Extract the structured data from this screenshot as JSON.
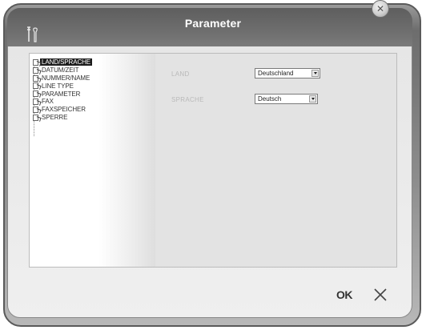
{
  "window": {
    "title": "Parameter",
    "close_icon": "close-icon",
    "app_icon": "tools-icon"
  },
  "tree": {
    "items": [
      {
        "label": "LAND/SPRACHE",
        "selected": true
      },
      {
        "label": "DATUM/ZEIT",
        "selected": false
      },
      {
        "label": "NUMMER/NAME",
        "selected": false
      },
      {
        "label": "LINE TYPE",
        "selected": false
      },
      {
        "label": "PARAMETER",
        "selected": false
      },
      {
        "label": "FAX",
        "selected": false
      },
      {
        "label": "FAXSPEICHER",
        "selected": false
      },
      {
        "label": "SPERRE",
        "selected": false
      }
    ]
  },
  "form": {
    "land_label": "LAND",
    "land_value": "Deutschland",
    "sprache_label": "SPRACHE",
    "sprache_value": "Deutsch"
  },
  "footer": {
    "ok_label": "OK",
    "cancel_icon": "x-icon"
  },
  "colors": {
    "titlebar": "#6e6e6e",
    "selection": "#1c1c1c",
    "panel": "#e3e3e3"
  }
}
